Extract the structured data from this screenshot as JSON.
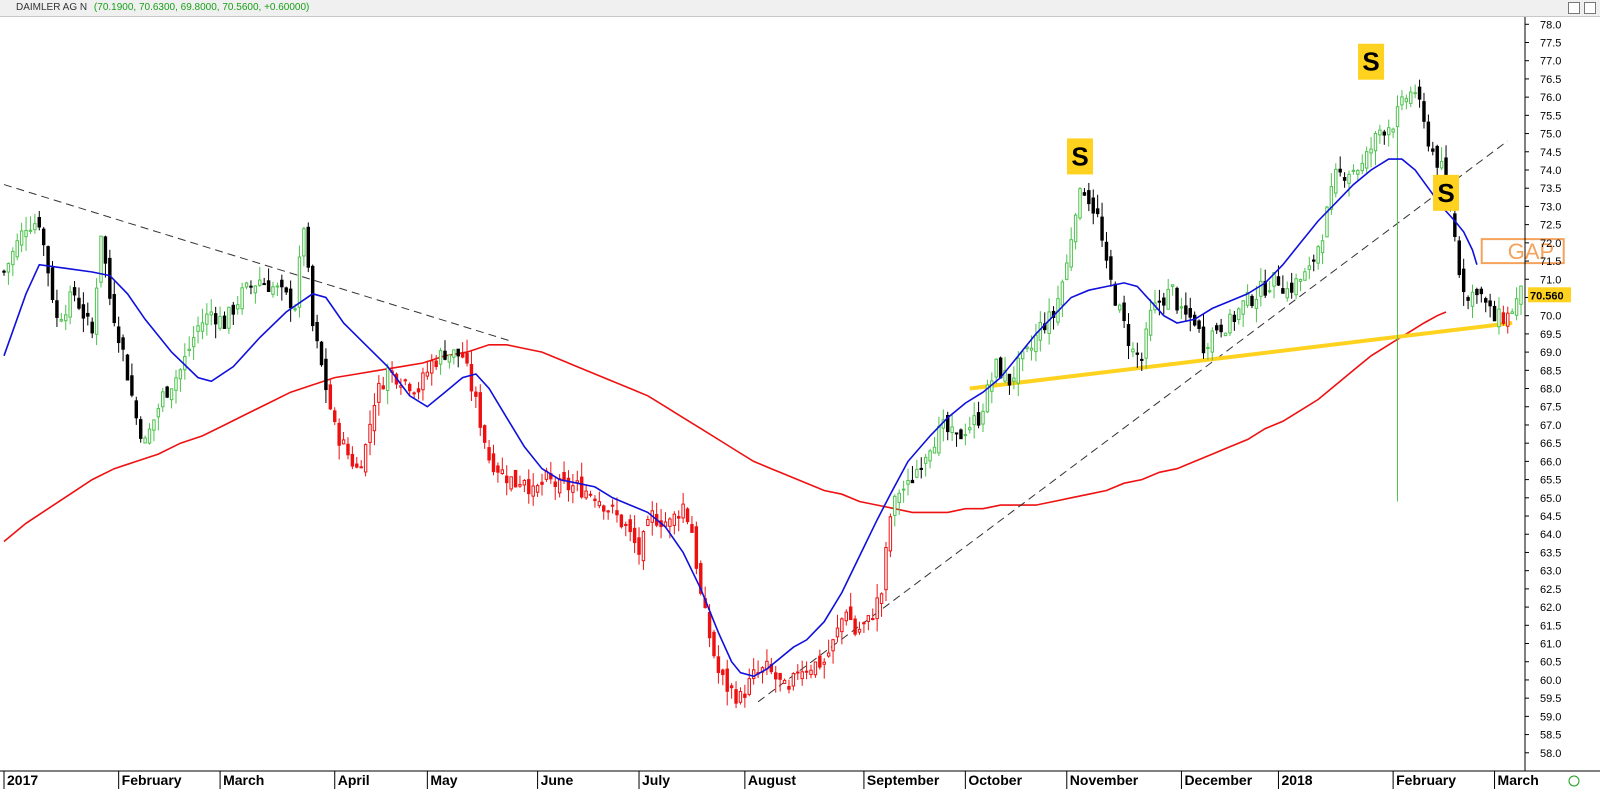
{
  "header": {
    "symbol": "DAIMLER AG N",
    "ohlc": "(70.1900, 70.6300, 69.8000, 70.5600, +0.60000)"
  },
  "last_price": "70.560",
  "colors": {
    "up": "#4dc24d",
    "down": "#000000",
    "below_ma": "#ee1111",
    "ma_fast": "#1010dd",
    "ma_slow": "#ee1111",
    "support": "#ffd21f",
    "trendline": "#333333",
    "gap": "#f5a25d",
    "price_label": "#ffd21f"
  },
  "chart_data": {
    "type": "candlestick",
    "title": "DAIMLER AG N",
    "ylim": [
      57.5,
      78.2
    ],
    "y_ticks": [
      "58.0",
      "58.5",
      "59.0",
      "59.5",
      "60.0",
      "60.5",
      "61.0",
      "61.5",
      "62.0",
      "62.5",
      "63.0",
      "63.5",
      "64.0",
      "64.5",
      "65.0",
      "65.5",
      "66.0",
      "66.5",
      "67.0",
      "67.5",
      "68.0",
      "68.5",
      "69.0",
      "69.5",
      "70.0",
      "70.5",
      "71.0",
      "71.5",
      "72.0",
      "72.5",
      "73.0",
      "73.5",
      "74.0",
      "74.5",
      "75.0",
      "75.5",
      "76.0",
      "76.5",
      "77.0",
      "77.5",
      "78.0"
    ],
    "x_labels": [
      {
        "label": "2017",
        "day": 0
      },
      {
        "label": "February",
        "day": 26
      },
      {
        "label": "March",
        "day": 49
      },
      {
        "label": "April",
        "day": 75
      },
      {
        "label": "May",
        "day": 96
      },
      {
        "label": "June",
        "day": 121
      },
      {
        "label": "July",
        "day": 144
      },
      {
        "label": "August",
        "day": 168
      },
      {
        "label": "September",
        "day": 195
      },
      {
        "label": "October",
        "day": 218
      },
      {
        "label": "November",
        "day": 241
      },
      {
        "label": "December",
        "day": 267
      },
      {
        "label": "2018",
        "day": 289
      },
      {
        "label": "February",
        "day": 315
      },
      {
        "label": "March",
        "day": 338
      }
    ],
    "x_range": [
      0,
      344
    ],
    "anchors": [
      [
        0,
        71.2
      ],
      [
        5,
        72.5
      ],
      [
        8,
        72.6
      ],
      [
        12,
        69.9
      ],
      [
        16,
        70.6
      ],
      [
        20,
        69.5
      ],
      [
        22,
        72.3
      ],
      [
        24,
        70.5
      ],
      [
        27,
        69.0
      ],
      [
        30,
        67.2
      ],
      [
        32,
        66.5
      ],
      [
        36,
        67.8
      ],
      [
        40,
        68.5
      ],
      [
        44,
        69.7
      ],
      [
        47,
        70.1
      ],
      [
        50,
        69.8
      ],
      [
        54,
        70.6
      ],
      [
        58,
        71.0
      ],
      [
        62,
        70.7
      ],
      [
        66,
        70.3
      ],
      [
        68,
        72.5
      ],
      [
        70,
        69.7
      ],
      [
        72,
        68.6
      ],
      [
        75,
        66.9
      ],
      [
        78,
        66.2
      ],
      [
        80,
        65.8
      ],
      [
        82,
        66.4
      ],
      [
        84,
        67.7
      ],
      [
        87,
        68.5
      ],
      [
        90,
        68.3
      ],
      [
        94,
        68.0
      ],
      [
        97,
        68.7
      ],
      [
        100,
        69.0
      ],
      [
        104,
        68.9
      ],
      [
        107,
        67.6
      ],
      [
        110,
        66.1
      ],
      [
        113,
        65.7
      ],
      [
        116,
        65.4
      ],
      [
        118,
        65.6
      ],
      [
        120,
        65.1
      ],
      [
        123,
        65.5
      ],
      [
        126,
        65.3
      ],
      [
        130,
        65.3
      ],
      [
        134,
        65.1
      ],
      [
        138,
        64.6
      ],
      [
        141,
        64.2
      ],
      [
        144,
        63.5
      ],
      [
        147,
        64.5
      ],
      [
        151,
        64.3
      ],
      [
        154,
        64.8
      ],
      [
        156,
        64.1
      ],
      [
        158,
        62.3
      ],
      [
        160,
        61.2
      ],
      [
        162,
        60.2
      ],
      [
        164,
        59.8
      ],
      [
        167,
        59.5
      ],
      [
        170,
        60.1
      ],
      [
        173,
        60.3
      ],
      [
        176,
        59.9
      ],
      [
        178,
        59.6
      ],
      [
        180,
        60.3
      ],
      [
        183,
        60.4
      ],
      [
        186,
        60.5
      ],
      [
        188,
        61.0
      ],
      [
        191,
        62.0
      ],
      [
        193,
        61.3
      ],
      [
        196,
        61.6
      ],
      [
        199,
        62.4
      ],
      [
        201,
        64.5
      ],
      [
        203,
        65.2
      ],
      [
        205,
        65.3
      ],
      [
        207,
        65.8
      ],
      [
        210,
        66.5
      ],
      [
        213,
        66.9
      ],
      [
        216,
        66.6
      ],
      [
        218,
        66.9
      ],
      [
        221,
        67.2
      ],
      [
        223,
        67.9
      ],
      [
        225,
        68.6
      ],
      [
        228,
        68.2
      ],
      [
        230,
        68.6
      ],
      [
        233,
        69.1
      ],
      [
        235,
        69.7
      ],
      [
        238,
        70.0
      ],
      [
        241,
        71.4
      ],
      [
        243,
        73.0
      ],
      [
        245,
        73.5
      ],
      [
        248,
        72.7
      ],
      [
        250,
        71.3
      ],
      [
        253,
        70.1
      ],
      [
        256,
        69.0
      ],
      [
        258,
        68.8
      ],
      [
        260,
        70.0
      ],
      [
        262,
        70.4
      ],
      [
        265,
        70.7
      ],
      [
        267,
        70.0
      ],
      [
        270,
        69.9
      ],
      [
        272,
        69.2
      ],
      [
        275,
        69.7
      ],
      [
        278,
        69.8
      ],
      [
        281,
        70.3
      ],
      [
        284,
        70.6
      ],
      [
        287,
        70.9
      ],
      [
        289,
        71.0
      ],
      [
        291,
        70.7
      ],
      [
        294,
        71.0
      ],
      [
        296,
        71.2
      ],
      [
        299,
        72.3
      ],
      [
        302,
        73.8
      ],
      [
        305,
        74.0
      ],
      [
        308,
        74.1
      ],
      [
        310,
        74.6
      ],
      [
        312,
        75.1
      ],
      [
        315,
        75.3
      ],
      [
        318,
        76.0
      ],
      [
        320,
        76.2
      ],
      [
        322,
        75.2
      ],
      [
        324,
        74.5
      ],
      [
        326,
        74.0
      ],
      [
        328,
        73.0
      ],
      [
        330,
        71.3
      ],
      [
        332,
        70.4
      ],
      [
        334,
        70.8
      ],
      [
        336,
        70.3
      ],
      [
        338,
        69.9
      ],
      [
        341,
        70.0
      ],
      [
        344,
        70.6
      ]
    ],
    "ma_fast": [
      [
        0,
        68.9
      ],
      [
        5,
        70.6
      ],
      [
        8,
        71.4
      ],
      [
        14,
        71.3
      ],
      [
        20,
        71.2
      ],
      [
        24,
        71.1
      ],
      [
        28,
        70.6
      ],
      [
        32,
        69.9
      ],
      [
        38,
        69.0
      ],
      [
        44,
        68.3
      ],
      [
        47,
        68.2
      ],
      [
        52,
        68.6
      ],
      [
        58,
        69.4
      ],
      [
        64,
        70.1
      ],
      [
        70,
        70.6
      ],
      [
        73,
        70.5
      ],
      [
        77,
        69.8
      ],
      [
        82,
        69.2
      ],
      [
        87,
        68.6
      ],
      [
        92,
        67.8
      ],
      [
        96,
        67.5
      ],
      [
        100,
        67.9
      ],
      [
        104,
        68.3
      ],
      [
        107,
        68.4
      ],
      [
        110,
        68.0
      ],
      [
        114,
        67.2
      ],
      [
        118,
        66.4
      ],
      [
        122,
        65.8
      ],
      [
        126,
        65.5
      ],
      [
        130,
        65.4
      ],
      [
        134,
        65.3
      ],
      [
        138,
        65.0
      ],
      [
        142,
        64.8
      ],
      [
        146,
        64.6
      ],
      [
        150,
        64.2
      ],
      [
        154,
        63.5
      ],
      [
        158,
        62.5
      ],
      [
        162,
        61.3
      ],
      [
        165,
        60.5
      ],
      [
        167,
        60.2
      ],
      [
        170,
        60.1
      ],
      [
        173,
        60.3
      ],
      [
        176,
        60.6
      ],
      [
        179,
        60.9
      ],
      [
        182,
        61.1
      ],
      [
        186,
        61.6
      ],
      [
        190,
        62.4
      ],
      [
        194,
        63.4
      ],
      [
        198,
        64.4
      ],
      [
        201,
        65.1
      ],
      [
        205,
        66.0
      ],
      [
        210,
        66.7
      ],
      [
        214,
        67.2
      ],
      [
        218,
        67.6
      ],
      [
        222,
        67.9
      ],
      [
        226,
        68.3
      ],
      [
        230,
        68.9
      ],
      [
        234,
        69.5
      ],
      [
        238,
        70.0
      ],
      [
        242,
        70.5
      ],
      [
        246,
        70.7
      ],
      [
        250,
        70.8
      ],
      [
        254,
        70.9
      ],
      [
        257,
        70.8
      ],
      [
        260,
        70.4
      ],
      [
        263,
        70.0
      ],
      [
        266,
        69.8
      ],
      [
        270,
        69.9
      ],
      [
        274,
        70.2
      ],
      [
        278,
        70.4
      ],
      [
        282,
        70.6
      ],
      [
        286,
        70.9
      ],
      [
        290,
        71.4
      ],
      [
        294,
        72.0
      ],
      [
        298,
        72.6
      ],
      [
        302,
        73.1
      ],
      [
        306,
        73.6
      ],
      [
        310,
        74.0
      ],
      [
        314,
        74.3
      ],
      [
        317,
        74.3
      ],
      [
        320,
        74.0
      ],
      [
        323,
        73.5
      ],
      [
        326,
        73.0
      ],
      [
        329,
        72.6
      ],
      [
        331,
        72.3
      ],
      [
        333,
        71.8
      ],
      [
        334,
        71.4
      ]
    ],
    "ma_slow": [
      [
        0,
        63.8
      ],
      [
        5,
        64.3
      ],
      [
        10,
        64.7
      ],
      [
        15,
        65.1
      ],
      [
        20,
        65.5
      ],
      [
        25,
        65.8
      ],
      [
        30,
        66.0
      ],
      [
        35,
        66.2
      ],
      [
        40,
        66.5
      ],
      [
        45,
        66.7
      ],
      [
        50,
        67.0
      ],
      [
        55,
        67.3
      ],
      [
        60,
        67.6
      ],
      [
        65,
        67.9
      ],
      [
        70,
        68.1
      ],
      [
        75,
        68.3
      ],
      [
        80,
        68.4
      ],
      [
        85,
        68.5
      ],
      [
        90,
        68.6
      ],
      [
        95,
        68.7
      ],
      [
        100,
        68.9
      ],
      [
        105,
        69.0
      ],
      [
        110,
        69.2
      ],
      [
        114,
        69.2
      ],
      [
        118,
        69.1
      ],
      [
        122,
        69.0
      ],
      [
        126,
        68.8
      ],
      [
        130,
        68.6
      ],
      [
        134,
        68.4
      ],
      [
        138,
        68.2
      ],
      [
        142,
        68.0
      ],
      [
        146,
        67.8
      ],
      [
        150,
        67.5
      ],
      [
        154,
        67.2
      ],
      [
        158,
        66.9
      ],
      [
        162,
        66.6
      ],
      [
        166,
        66.3
      ],
      [
        170,
        66.0
      ],
      [
        174,
        65.8
      ],
      [
        178,
        65.6
      ],
      [
        182,
        65.4
      ],
      [
        186,
        65.2
      ],
      [
        190,
        65.1
      ],
      [
        194,
        64.9
      ],
      [
        198,
        64.8
      ],
      [
        202,
        64.7
      ],
      [
        206,
        64.6
      ],
      [
        210,
        64.6
      ],
      [
        214,
        64.6
      ],
      [
        218,
        64.7
      ],
      [
        222,
        64.7
      ],
      [
        226,
        64.8
      ],
      [
        230,
        64.8
      ],
      [
        234,
        64.8
      ],
      [
        238,
        64.9
      ],
      [
        242,
        65.0
      ],
      [
        246,
        65.1
      ],
      [
        250,
        65.2
      ],
      [
        254,
        65.4
      ],
      [
        258,
        65.5
      ],
      [
        262,
        65.7
      ],
      [
        266,
        65.8
      ],
      [
        270,
        66.0
      ],
      [
        274,
        66.2
      ],
      [
        278,
        66.4
      ],
      [
        282,
        66.6
      ],
      [
        286,
        66.9
      ],
      [
        290,
        67.1
      ],
      [
        294,
        67.4
      ],
      [
        298,
        67.7
      ],
      [
        302,
        68.1
      ],
      [
        306,
        68.5
      ],
      [
        310,
        68.9
      ],
      [
        314,
        69.2
      ],
      [
        318,
        69.5
      ],
      [
        322,
        69.8
      ],
      [
        325,
        70.0
      ],
      [
        327,
        70.1
      ]
    ],
    "trendlines": [
      {
        "style": "dashed",
        "from": [
          0,
          73.6
        ],
        "to": [
          115,
          69.3
        ]
      },
      {
        "style": "dashed",
        "from": [
          171,
          59.4
        ],
        "to": [
          341,
          74.8
        ]
      },
      {
        "style": "solid",
        "from": [
          219,
          68.0
        ],
        "to": [
          342,
          69.8
        ]
      }
    ],
    "annotations": [
      {
        "text": "S",
        "day": 244,
        "price": 74.4
      },
      {
        "text": "S",
        "day": 310,
        "price": 77.0
      },
      {
        "text": "S",
        "day": 327,
        "price": 73.4
      },
      {
        "text": "GAP",
        "day": 336,
        "price": 71.8
      }
    ],
    "spike_low": {
      "day": 316,
      "price": 64.9
    },
    "legend": "none"
  }
}
